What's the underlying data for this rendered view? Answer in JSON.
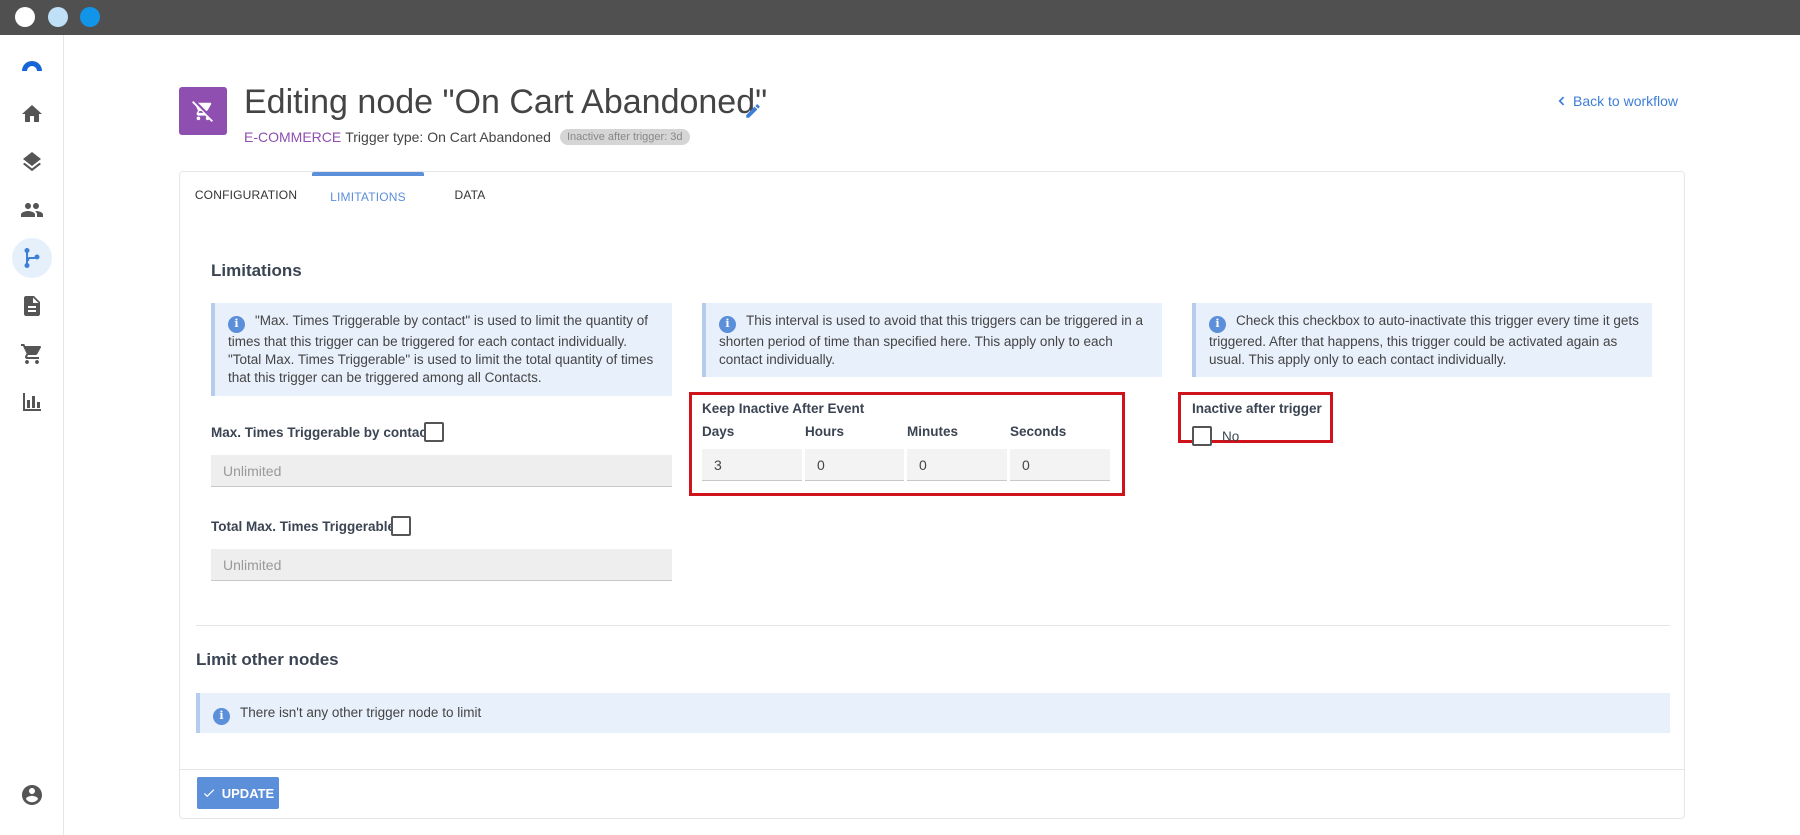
{
  "window": {
    "controls": [
      "close",
      "minimize",
      "maximize"
    ]
  },
  "sidebar": {
    "items": [
      {
        "name": "logo",
        "icon": "logo-icon"
      },
      {
        "name": "home",
        "icon": "home-icon"
      },
      {
        "name": "layers",
        "icon": "layers-icon"
      },
      {
        "name": "contacts",
        "icon": "people-icon"
      },
      {
        "name": "workflow",
        "icon": "workflow-icon",
        "active": true
      },
      {
        "name": "documents",
        "icon": "document-icon"
      },
      {
        "name": "cart",
        "icon": "cart-icon"
      },
      {
        "name": "reports",
        "icon": "bar-chart-icon"
      },
      {
        "name": "account",
        "icon": "account-icon"
      }
    ]
  },
  "header": {
    "title": "Editing node \"On Cart Abandoned\"",
    "category": "E-COMMERCE",
    "trigger_type": "Trigger type: On Cart Abandoned",
    "badge": "Inactive after trigger: 3d",
    "back_link": "Back to workflow",
    "node_icon": "remove-cart-icon",
    "node_color": "#8e4fb0"
  },
  "tabs": [
    {
      "label": "CONFIGURATION",
      "active": false
    },
    {
      "label": "LIMITATIONS",
      "active": true
    },
    {
      "label": "DATA",
      "active": false
    }
  ],
  "limitations": {
    "title": "Limitations",
    "info_max_times": "\"Max. Times Triggerable by contact\" is used to limit the quantity of times that this trigger can be triggered for each contact individually. \"Total Max. Times Triggerable\" is used to limit the total quantity of times that this trigger can be triggered among all Contacts.",
    "info_interval": "This interval is used to avoid that this triggers can be triggered in a shorten period of time than specified here. This apply only to each contact individually.",
    "info_inactive": "Check this checkbox to auto-inactivate this trigger every time it gets triggered. After that happens, this trigger could be activated again as usual. This apply only to each contact individually.",
    "max_by_contact": {
      "label": "Max. Times Triggerable by contact",
      "placeholder": "Unlimited",
      "checked": false
    },
    "total_max": {
      "label": "Total Max. Times Triggerable",
      "placeholder": "Unlimited",
      "checked": false
    },
    "keep_inactive": {
      "label": "Keep Inactive After Event",
      "days": {
        "label": "Days",
        "value": "3"
      },
      "hours": {
        "label": "Hours",
        "value": "0"
      },
      "minutes": {
        "label": "Minutes",
        "value": "0"
      },
      "seconds": {
        "label": "Seconds",
        "value": "0"
      }
    },
    "inactive_after_trigger": {
      "label": "Inactive after trigger",
      "value_label": "No",
      "checked": false
    }
  },
  "limit_other_nodes": {
    "title": "Limit other nodes",
    "info": "There isn't any other trigger node to limit"
  },
  "footer": {
    "update_label": "UPDATE"
  },
  "colors": {
    "accent": "#5b8fd9",
    "highlight": "#d0121b",
    "titlebar": "#505050"
  }
}
